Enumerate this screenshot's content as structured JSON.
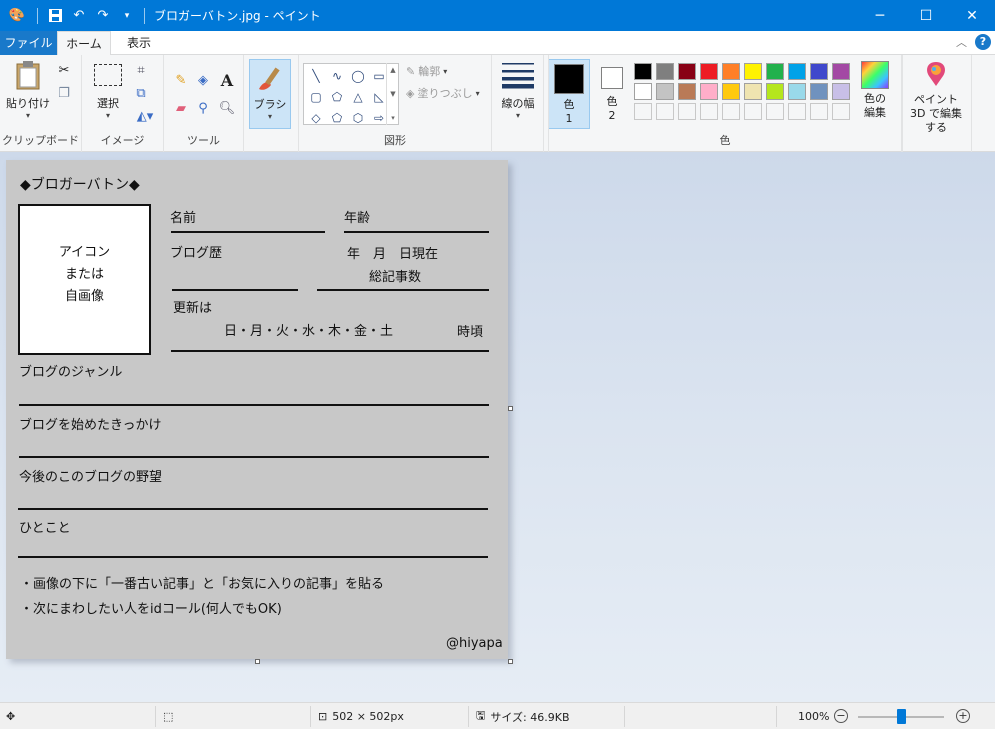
{
  "window": {
    "title": "ブロガーバトン.jpg - ペイント",
    "minimize": "─",
    "maximize": "☐",
    "close": "✕"
  },
  "tabs": {
    "file": "ファイル",
    "home": "ホーム",
    "view": "表示"
  },
  "ribbon": {
    "clipboard": {
      "paste": "貼り付け",
      "label": "クリップボード"
    },
    "image": {
      "select": "選択",
      "label": "イメージ"
    },
    "tools": {
      "label": "ツール"
    },
    "brush": "ブラシ",
    "shapes": {
      "outline": "輪郭",
      "fill": "塗りつぶし",
      "label": "図形"
    },
    "line_width": "線の幅",
    "colors": {
      "color1": "色",
      "color1_num": "1",
      "color2": "色",
      "color2_num": "2",
      "edit": "色の編集",
      "label": "色",
      "palette_row1": [
        "#000000",
        "#7f7f7f",
        "#880015",
        "#ed1c24",
        "#ff7f27",
        "#fff200",
        "#22b14c",
        "#00a2e8",
        "#3f48cc",
        "#a349a4"
      ],
      "palette_row2": [
        "#ffffff",
        "#c3c3c3",
        "#b97a57",
        "#ffaec9",
        "#ffc90e",
        "#efe4b0",
        "#b5e61d",
        "#99d9ea",
        "#7092be",
        "#c8bfe7"
      ]
    },
    "paint3d": "ペイント 3D で編集する"
  },
  "canvas": {
    "heading": "◆ブロガーバトン◆",
    "icon_box": [
      "アイコン",
      "または",
      "自画像"
    ],
    "name": "名前",
    "age": "年齢",
    "blog_history": "ブログ歴",
    "as_of": "年　月　日現在",
    "total_posts": "総記事数",
    "update_label": "更新は",
    "weekdays": "日・月・火・水・木・金・土",
    "time_suffix": "時頃",
    "genre": "ブログのジャンル",
    "reason": "ブログを始めたきっかけ",
    "ambition": "今後のこのブログの野望",
    "comment": "ひとこと",
    "rule1": "・画像の下に「一番古い記事」と「お気に入りの記事」を貼る",
    "rule2": "・次にまわしたい人をidコール(何人でもOK)",
    "credit": "@hiyapa"
  },
  "status": {
    "dimensions": "502 × 502px",
    "size": "サイズ: 46.9KB",
    "zoom": "100%",
    "zoom_fraction": 0.5
  }
}
